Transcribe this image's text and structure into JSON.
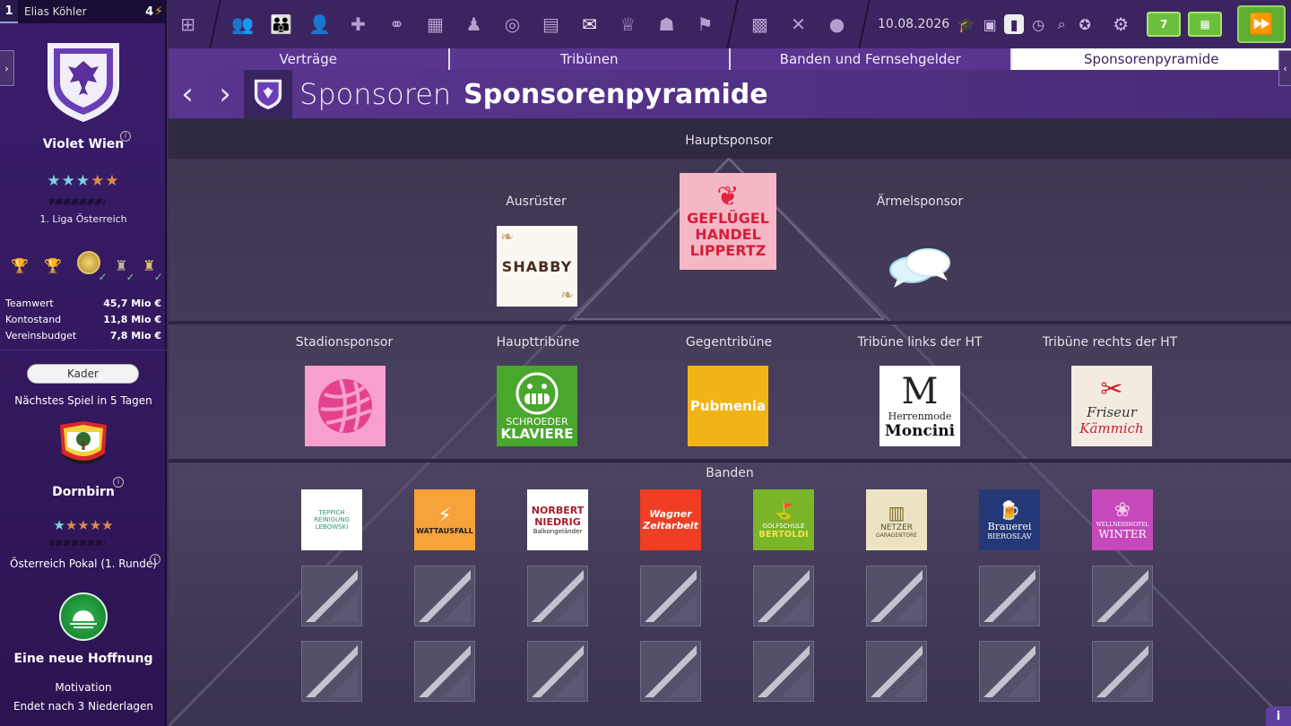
{
  "manager": {
    "rank": "1",
    "name": "Elias Köhler",
    "energy": "4"
  },
  "club": {
    "name": "Violet Wien",
    "league": "1. Liga Österreich",
    "stars": 5,
    "finance": [
      {
        "label": "Teamwert",
        "value": "45,7 Mio €"
      },
      {
        "label": "Kontostand",
        "value": "11,8 Mio €"
      },
      {
        "label": "Vereinsbudget",
        "value": "7,8 Mio €"
      }
    ]
  },
  "sidebar": {
    "kader_label": "Kader",
    "next_game": "Nächstes Spiel in 5 Tagen",
    "opponent": "Dornbirn",
    "competition": "Österreich Pokal (1. Runde)",
    "morale_title": "Eine neue Hoffnung",
    "morale_sub1": "Motivation",
    "morale_sub2": "Endet nach 3 Niederlagen"
  },
  "toolbar": {
    "date": "10.08.2026",
    "calendar_day": "7"
  },
  "tabs": [
    "Verträge",
    "Tribünen",
    "Banden und Fernsehgelder",
    "Sponsorenpyramide"
  ],
  "header": {
    "title": "Sponsoren",
    "subtitle": "Sponsorenpyramide"
  },
  "pyramid": {
    "hauptsponsor_label": "Hauptsponsor",
    "ausruester_label": "Ausrüster",
    "aermel_label": "Ärmelsponsor",
    "stadion_label": "Stadionsponsor",
    "haupttribuene_label": "Haupttribüne",
    "gegentribuene_label": "Gegentribüne",
    "trib_links_label": "Tribüne links der HT",
    "trib_rechts_label": "Tribüne rechts der HT",
    "banden_label": "Banden",
    "sponsors": {
      "haupt_l1": "GEFLÜGEL",
      "haupt_l2": "HANDEL",
      "haupt_l3": "LIPPERTZ",
      "ausruester": "SHABBY",
      "haupttrib_l1": "SCHROEDER",
      "haupttrib_l2": "KLAVIERE",
      "gegentrib": "Pubmenia",
      "trib_links_l1": "Herrenmode",
      "trib_links_l2": "Moncini",
      "trib_rechts_l1": "Friseur",
      "trib_rechts_l2": "Kämmich"
    },
    "banden": [
      {
        "l1": "TEPPICH",
        "l2": "REINIGUNG",
        "l3": "LEBOWSKI"
      },
      {
        "l1": "WATTAUSFALL",
        "l2": "",
        "l3": ""
      },
      {
        "l1": "NORBERT",
        "l2": "NIEDRIG",
        "l3": "Balkongeländer"
      },
      {
        "l1": "Wagner",
        "l2": "Zeitarbeit",
        "l3": ""
      },
      {
        "l1": "GOLFSCHULE",
        "l2": "BERTOLDI",
        "l3": ""
      },
      {
        "l1": "NETZER",
        "l2": "GARAGENTORE",
        "l3": ""
      },
      {
        "l1": "Brauerei",
        "l2": "BIEROSLAV",
        "l3": ""
      },
      {
        "l1": "WELLNESSHOTEL",
        "l2": "WINTER",
        "l3": ""
      }
    ]
  }
}
